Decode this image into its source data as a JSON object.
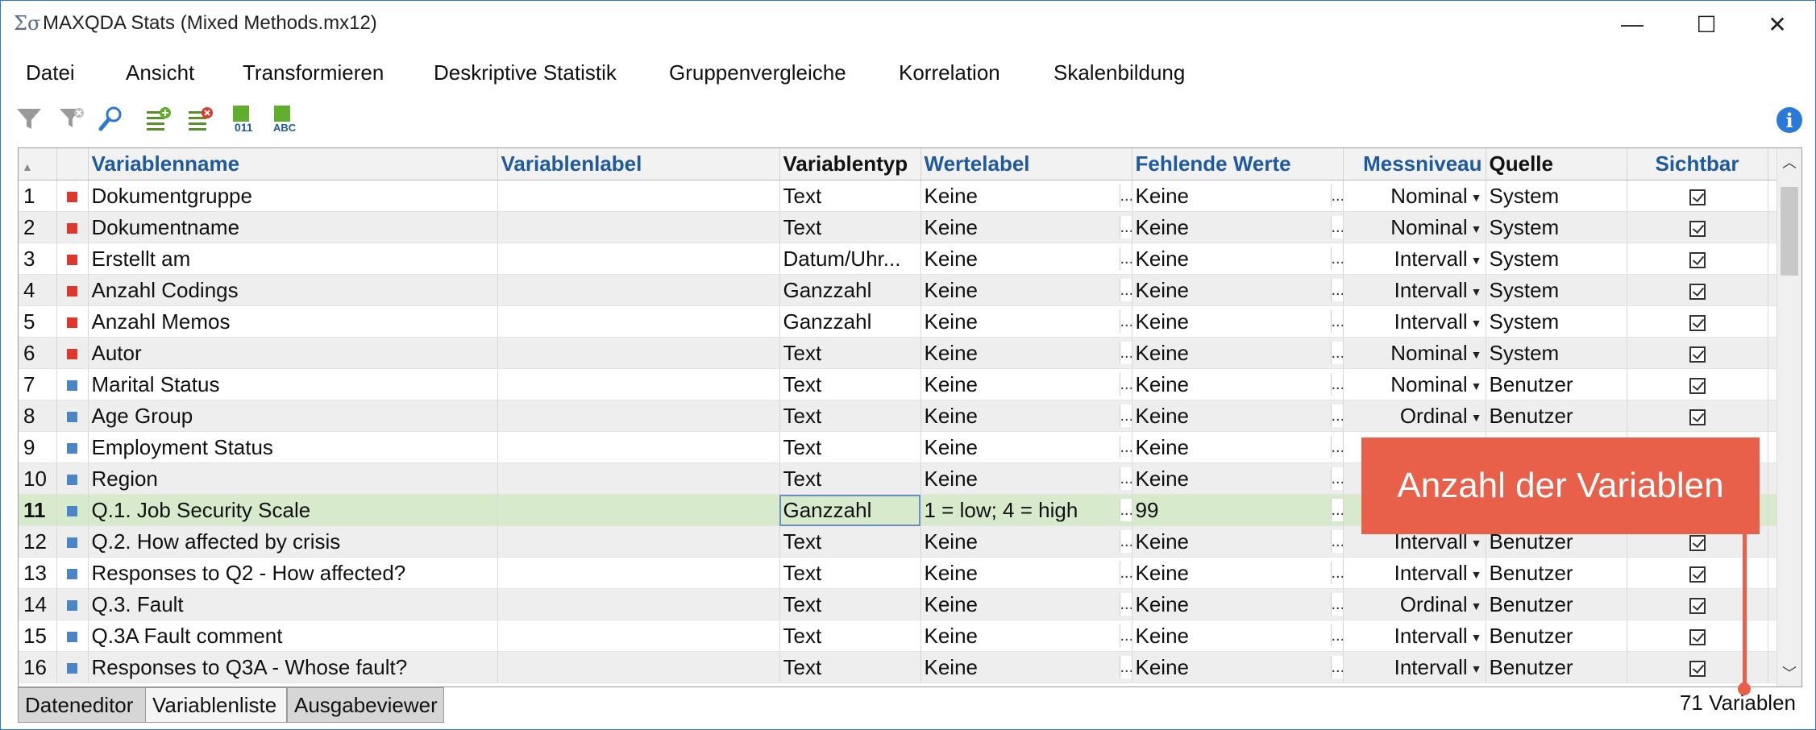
{
  "window": {
    "title": "MAXQDA Stats (Mixed Methods.mx12)",
    "app_icon": "Σσ",
    "minimize": "—",
    "maximize": "☐",
    "close": "✕"
  },
  "menu": [
    "Datei",
    "Ansicht",
    "Transformieren",
    "Deskriptive Statistik",
    "Gruppenvergleiche",
    "Korrelation",
    "Skalenbildung"
  ],
  "toolbar": {
    "icons": [
      "filter-icon",
      "clear-filter-icon",
      "search-icon",
      "add-variable-icon",
      "delete-variable-icon",
      "numeric-variable-icon",
      "text-variable-icon",
      "info-icon"
    ],
    "numeric_label": "011",
    "text_label": "ABC",
    "info_label": "i"
  },
  "table": {
    "columns": [
      "Variablenname",
      "Variablenlabel",
      "Variablentyp",
      "Wertelabel",
      "Fehlende Werte",
      "Messniveau",
      "Quelle",
      "Sichtbar"
    ],
    "rows": [
      {
        "num": "1",
        "name": "Dokumentgruppe",
        "label": "",
        "type": "Text",
        "valuelabel": "Keine",
        "missing": "Keine",
        "level": "Nominal",
        "source": "System"
      },
      {
        "num": "2",
        "name": "Dokumentname",
        "label": "",
        "type": "Text",
        "valuelabel": "Keine",
        "missing": "Keine",
        "level": "Nominal",
        "source": "System"
      },
      {
        "num": "3",
        "name": "Erstellt am",
        "label": "",
        "type": "Datum/Uhr...",
        "valuelabel": "Keine",
        "missing": "Keine",
        "level": "Intervall",
        "source": "System"
      },
      {
        "num": "4",
        "name": "Anzahl Codings",
        "label": "",
        "type": "Ganzzahl",
        "valuelabel": "Keine",
        "missing": "Keine",
        "level": "Intervall",
        "source": "System"
      },
      {
        "num": "5",
        "name": "Anzahl Memos",
        "label": "",
        "type": "Ganzzahl",
        "valuelabel": "Keine",
        "missing": "Keine",
        "level": "Intervall",
        "source": "System"
      },
      {
        "num": "6",
        "name": "Autor",
        "label": "",
        "type": "Text",
        "valuelabel": "Keine",
        "missing": "Keine",
        "level": "Nominal",
        "source": "System"
      },
      {
        "num": "7",
        "name": "Marital Status",
        "label": "",
        "type": "Text",
        "valuelabel": "Keine",
        "missing": "Keine",
        "level": "Nominal",
        "source": "Benutzer"
      },
      {
        "num": "8",
        "name": "Age Group",
        "label": "",
        "type": "Text",
        "valuelabel": "Keine",
        "missing": "Keine",
        "level": "Ordinal",
        "source": "Benutzer"
      },
      {
        "num": "9",
        "name": "Employment Status",
        "label": "",
        "type": "Text",
        "valuelabel": "Keine",
        "missing": "Keine",
        "level": "",
        "source": ""
      },
      {
        "num": "10",
        "name": "Region",
        "label": "",
        "type": "Text",
        "valuelabel": "Keine",
        "missing": "Keine",
        "level": "",
        "source": ""
      },
      {
        "num": "11",
        "name": "Q.1. Job Security Scale",
        "label": "",
        "type": "Ganzzahl",
        "valuelabel": "1 = low; 4 = high",
        "missing": "99",
        "level": "",
        "source": ""
      },
      {
        "num": "12",
        "name": "Q.2. How affected by crisis",
        "label": "",
        "type": "Text",
        "valuelabel": "Keine",
        "missing": "Keine",
        "level": "Intervall",
        "source": "Benutzer"
      },
      {
        "num": "13",
        "name": "Responses to Q2 - How affected?",
        "label": "",
        "type": "Text",
        "valuelabel": "Keine",
        "missing": "Keine",
        "level": "Intervall",
        "source": "Benutzer"
      },
      {
        "num": "14",
        "name": "Q.3. Fault",
        "label": "",
        "type": "Text",
        "valuelabel": "Keine",
        "missing": "Keine",
        "level": "Ordinal",
        "source": "Benutzer"
      },
      {
        "num": "15",
        "name": "Q.3A Fault comment",
        "label": "",
        "type": "Text",
        "valuelabel": "Keine",
        "missing": "Keine",
        "level": "Intervall",
        "source": "Benutzer"
      },
      {
        "num": "16",
        "name": "Responses to Q3A - Whose fault?",
        "label": "",
        "type": "Text",
        "valuelabel": "Keine",
        "missing": "Keine",
        "level": "Intervall",
        "source": "Benutzer"
      }
    ],
    "system_color": "#e0372d",
    "user_color": "#4a86c5",
    "ellipsis": "..."
  },
  "tabs": [
    "Dateneditor",
    "Variablenliste",
    "Ausgabeviewer"
  ],
  "active_tab": "Variablenliste",
  "status": "71 Variablen",
  "callout": "Anzahl der Variablen",
  "colors": {
    "header_blue": "#1f5a9e",
    "selected_row": "#d7eacc",
    "callout": "#e9604a",
    "accent": "#2b79d6"
  }
}
